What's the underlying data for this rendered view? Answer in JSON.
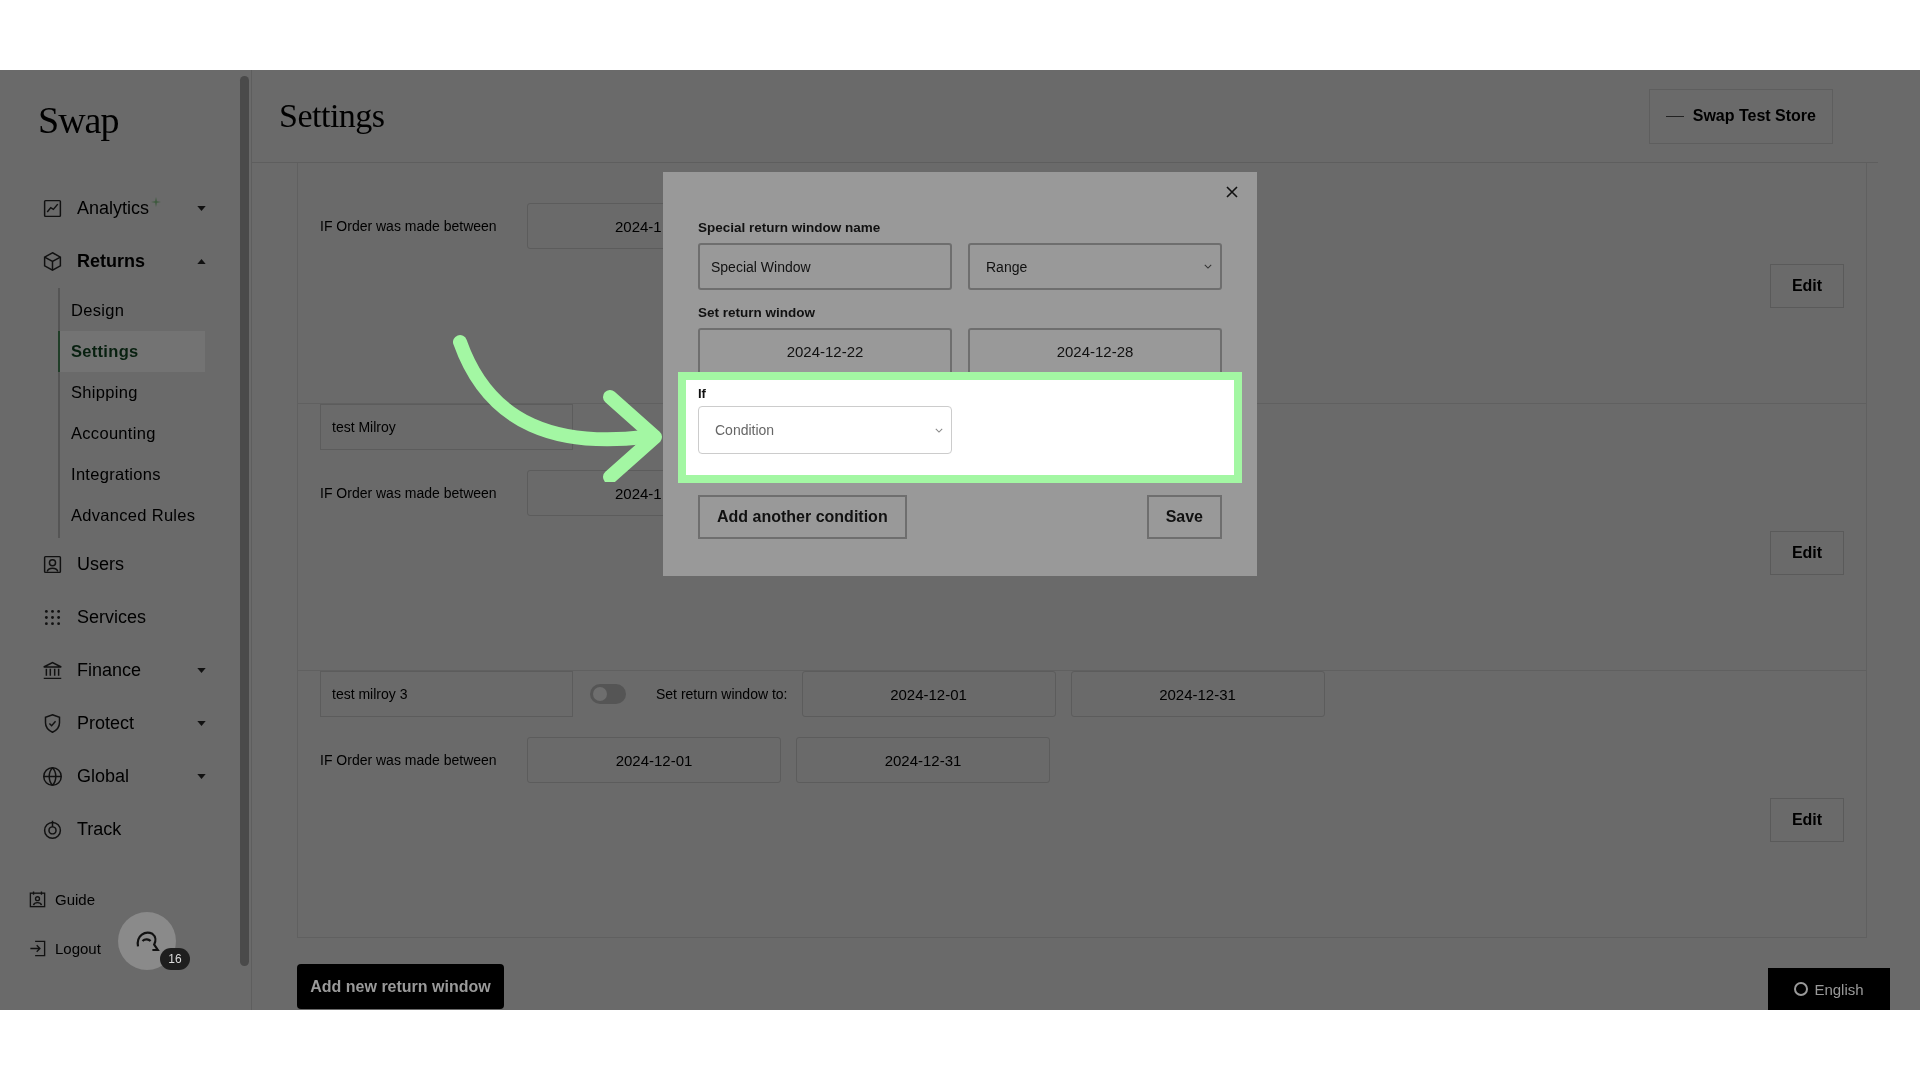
{
  "logo": "Swap",
  "sidebar": {
    "items": [
      {
        "label": "Analytics",
        "kind": "menu",
        "expanded": false
      },
      {
        "label": "Returns",
        "kind": "menu",
        "expanded": true,
        "children": [
          {
            "label": "Design",
            "selected": false
          },
          {
            "label": "Settings",
            "selected": true
          },
          {
            "label": "Shipping",
            "selected": false
          },
          {
            "label": "Accounting",
            "selected": false
          },
          {
            "label": "Integrations",
            "selected": false
          },
          {
            "label": "Advanced Rules",
            "selected": false
          }
        ]
      },
      {
        "label": "Users",
        "kind": "link"
      },
      {
        "label": "Services",
        "kind": "link"
      },
      {
        "label": "Finance",
        "kind": "menu",
        "expanded": false
      },
      {
        "label": "Protect",
        "kind": "menu",
        "expanded": false
      },
      {
        "label": "Global",
        "kind": "menu",
        "expanded": false
      },
      {
        "label": "Track",
        "kind": "link"
      }
    ],
    "footer": [
      {
        "label": "Guide"
      },
      {
        "label": "Logout"
      }
    ]
  },
  "chat_badge": "16",
  "header": {
    "title": "Settings",
    "store": "Swap Test Store"
  },
  "return_windows": [
    {
      "condition_label": "IF Order was made between",
      "condition_dates": [
        "2024-1"
      ],
      "edit": "Edit"
    },
    {
      "name": "test Milroy",
      "condition_label": "IF Order was made between",
      "condition_dates": [
        "2024-1"
      ],
      "edit": "Edit"
    },
    {
      "name": "test milroy 3",
      "toggle_on": false,
      "set_label": "Set return window to:",
      "set_dates": [
        "2024-12-01",
        "2024-12-31"
      ],
      "condition_label": "IF Order was made between",
      "condition_dates": [
        "2024-12-01",
        "2024-12-31"
      ],
      "edit": "Edit"
    }
  ],
  "add_button": "Add new return window",
  "language": "English",
  "modal": {
    "name_label": "Special return window name",
    "name_value": "Special Window",
    "type_value": "Range",
    "window_label": "Set return window",
    "window_dates": [
      "2024-12-22",
      "2024-12-28"
    ],
    "highlight": {
      "if_label": "If",
      "condition_placeholder": "Condition"
    },
    "add_condition": "Add another condition",
    "save": "Save"
  }
}
